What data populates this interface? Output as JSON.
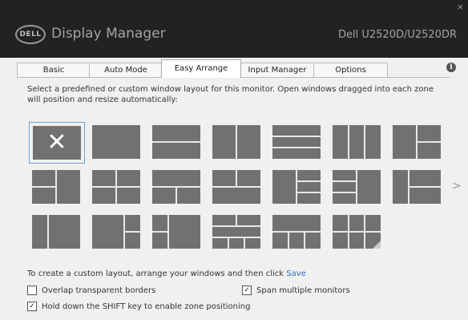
{
  "window": {
    "close_glyph": "×",
    "logo_text": "DELL",
    "app_title": "Display Manager",
    "monitor_name": "Dell U2520D/U2520DR"
  },
  "tabs": [
    {
      "label": "Basic",
      "active": false
    },
    {
      "label": "Auto Mode",
      "active": false
    },
    {
      "label": "Easy Arrange",
      "active": true
    },
    {
      "label": "Input Manager",
      "active": false
    },
    {
      "label": "Options",
      "active": false
    }
  ],
  "info_glyph": "i",
  "description": "Select a predefined or custom window layout for this monitor.  Open windows dragged into each zone will position and resize automatically:",
  "layouts": {
    "selected_glyph": "✕",
    "next_glyph": ">",
    "selected_index": 0
  },
  "custom": {
    "text": "To create a custom layout, arrange your windows and then click ",
    "save_label": "Save"
  },
  "options": {
    "overlap": {
      "label": "Overlap transparent borders",
      "checked": false
    },
    "span": {
      "label": "Span multiple monitors",
      "checked": true
    },
    "shift": {
      "label": "Hold down the SHIFT key to enable zone positioning",
      "checked": true
    }
  },
  "colors": {
    "titlebar": "#222222",
    "tile": "#717171",
    "selection": "#6aa6d8",
    "link": "#2b6fb6"
  }
}
